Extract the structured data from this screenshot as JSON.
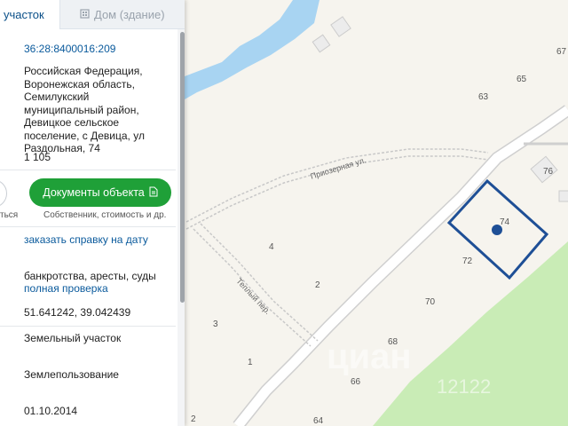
{
  "tabs": {
    "land": "участок",
    "building": "Дом (здание)"
  },
  "parcel": {
    "cadastral_number": "36:28:8400016:209",
    "address": "Российская Федерация, Воронежская область, Семилукский муниципальный район, Девицкое сельское поселение, с Девица, ул Раздольная, 74",
    "area": "1 105",
    "cut_text": "ться",
    "docs_button": "Документы объекта",
    "docs_caption": "Собственник, стоимость и др.",
    "order_ref": "заказать справку на дату",
    "bankruptcy": "банкротства, аресты, суды",
    "full_check": "полная проверка",
    "coordinates": "51.641242, 39.042439",
    "object_type": "Земельный участок",
    "land_use": "Землепользование",
    "date": "01.10.2014"
  },
  "map": {
    "streets": {
      "priozernaya": "Приозерная ул.",
      "teply": "Теплый пер."
    },
    "house_numbers": {
      "n67": "67",
      "n65": "65",
      "n63": "63",
      "n76": "76",
      "n74": "74",
      "n72": "72",
      "n70": "70",
      "n68": "68",
      "n66": "66",
      "n64": "64",
      "n4": "4",
      "n2": "2",
      "n3": "3",
      "n1": "1",
      "n2b": "2"
    },
    "watermark": "циан",
    "watermark_sub": "12122",
    "colors": {
      "background": "#f6f4ee",
      "water": "#a8d4f2",
      "park": "#c9ecb6",
      "parcel": "#1e4f96",
      "accent_green": "#1fa038"
    }
  }
}
